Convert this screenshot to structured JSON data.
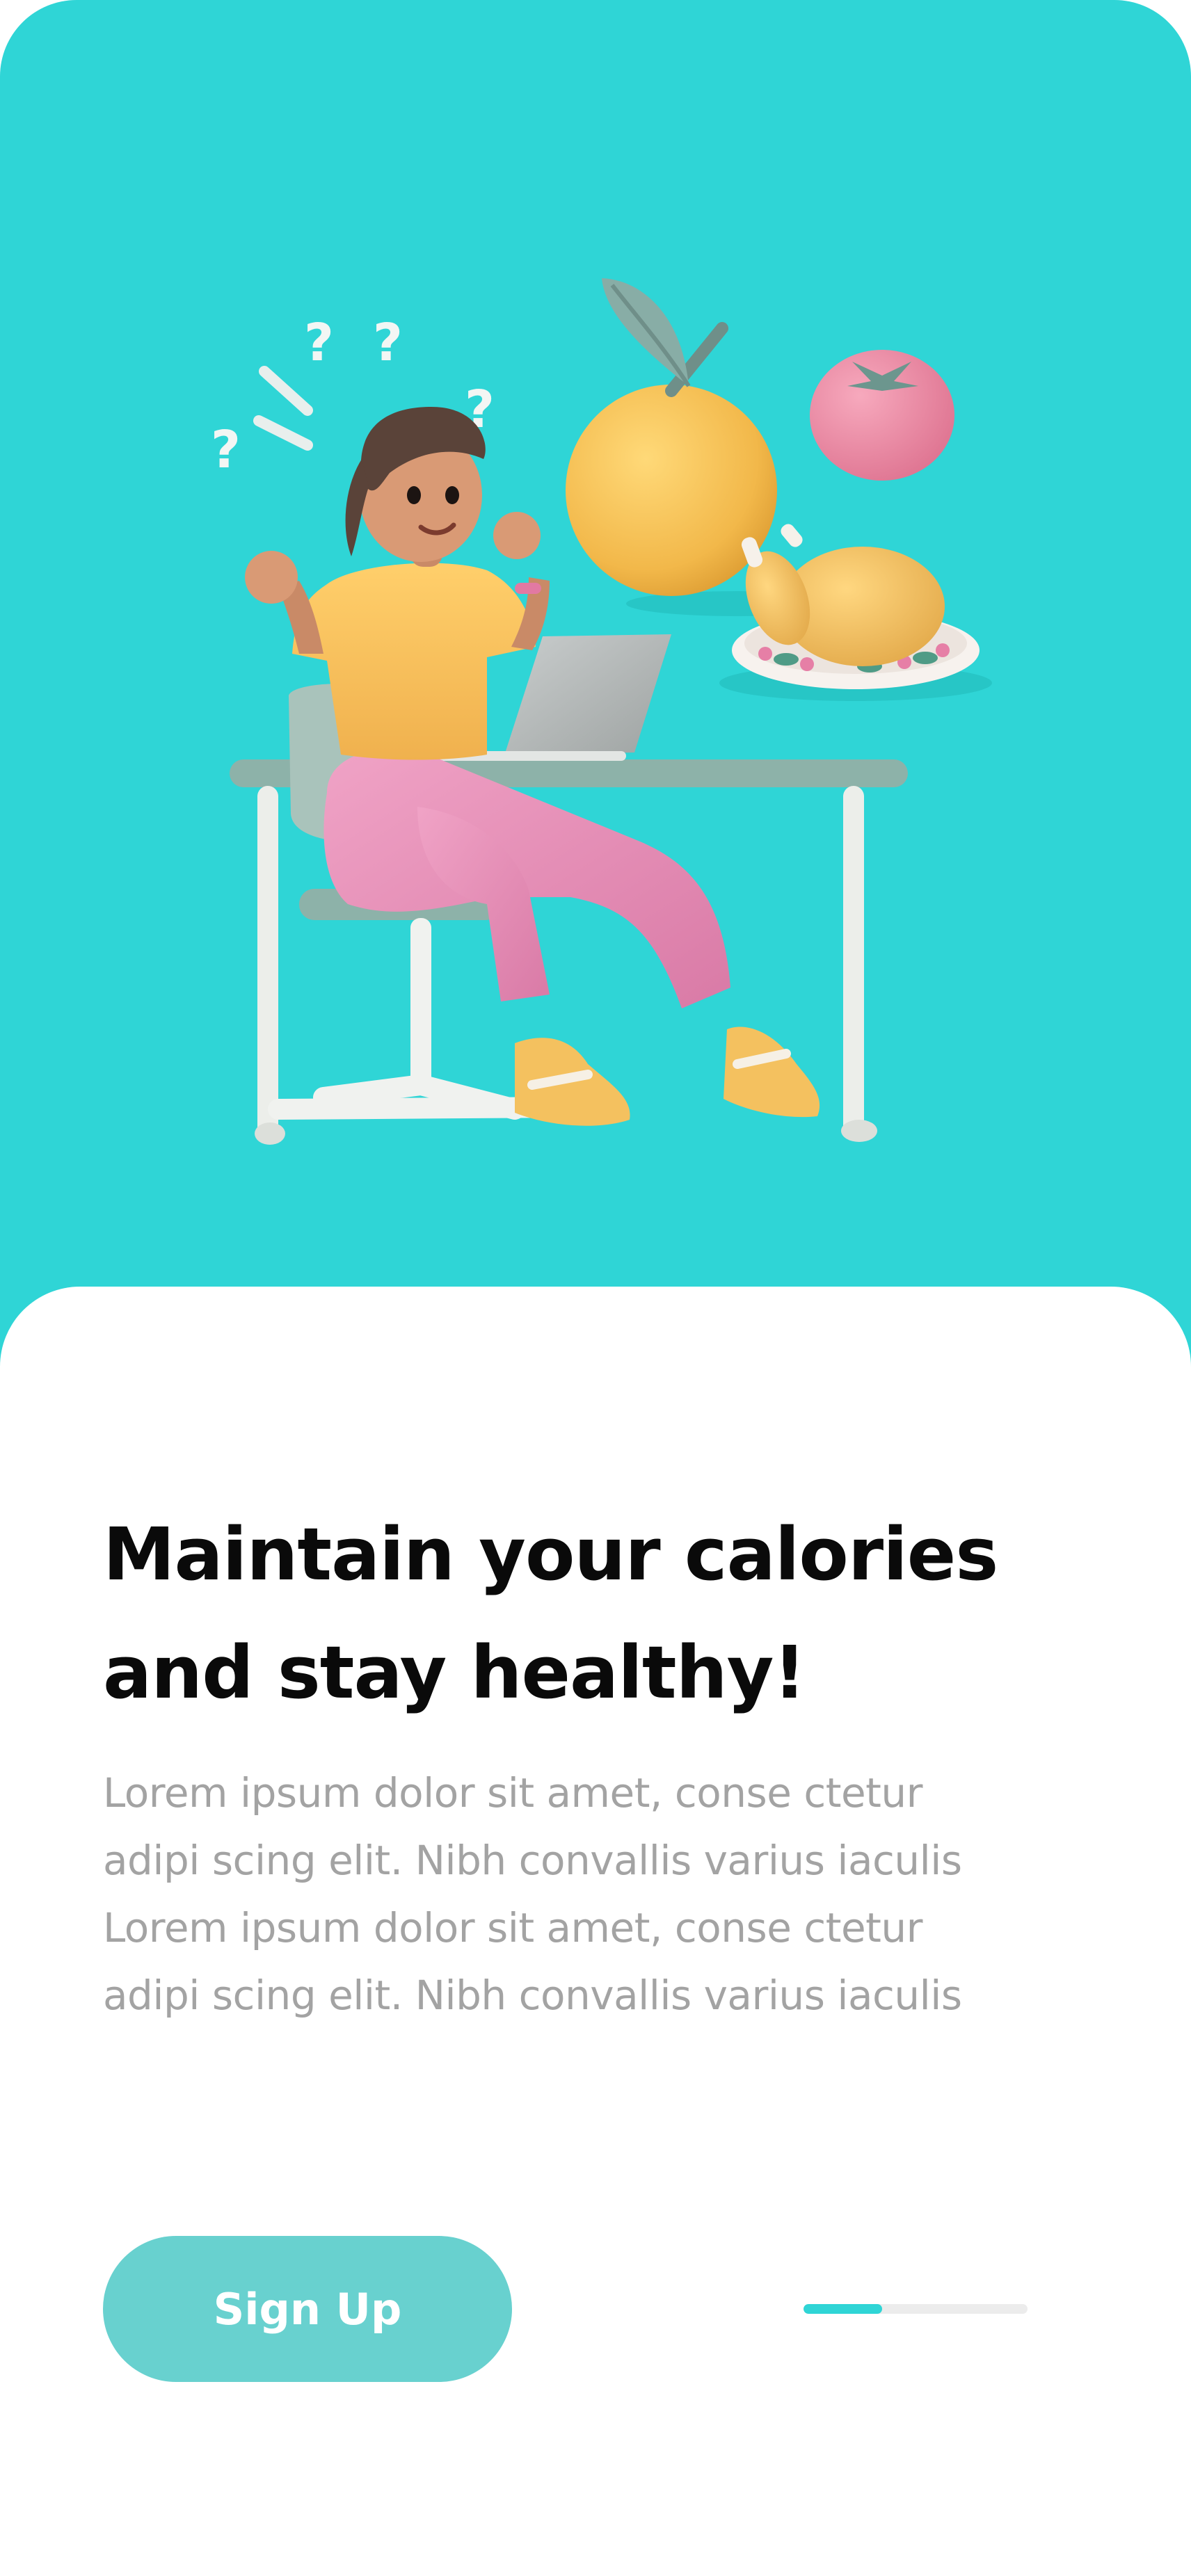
{
  "colors": {
    "accent": "#2fd5d6",
    "button": "#68d1cf",
    "title": "#0a0a0a",
    "body": "#a3a3a3"
  },
  "hero": {
    "illustration": "woman-at-desk-with-laptop-thinking-about-food-illustration"
  },
  "content": {
    "title_lines": [
      "Maintain your calories",
      "and stay healthy!"
    ],
    "body_lines": [
      "Lorem ipsum dolor sit amet, conse ctetur",
      "adipi scing elit. Nibh convallis varius iaculis",
      "Lorem ipsum dolor sit amet, conse ctetur",
      "adipi scing elit. Nibh convallis varius iaculis"
    ]
  },
  "actions": {
    "signup_label": "Sign Up"
  },
  "pager": {
    "progress": 0.35
  }
}
